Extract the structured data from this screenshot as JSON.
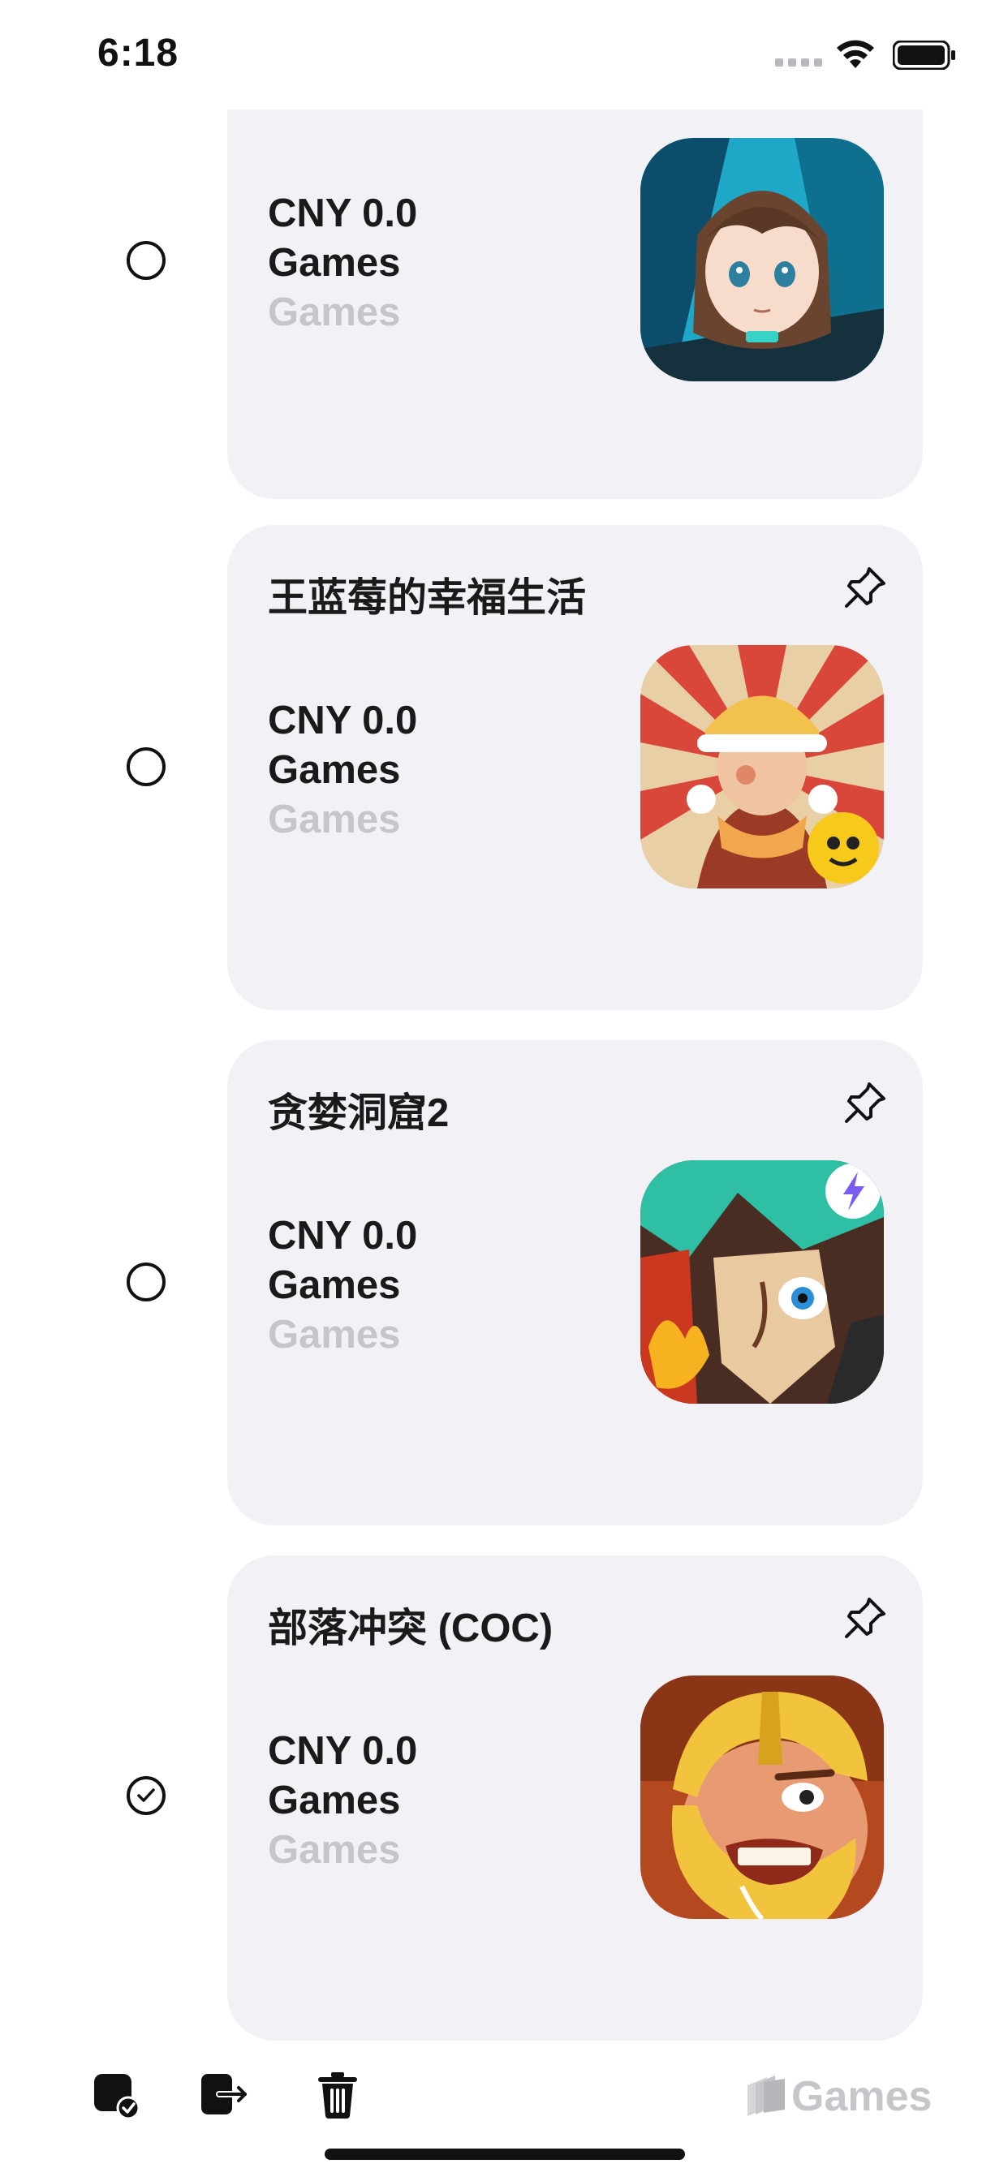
{
  "status_bar": {
    "time": "6:18"
  },
  "items": [
    {
      "title": "",
      "price": "CNY 0.0",
      "category": "Games",
      "genre": "Games",
      "selected": false,
      "icon": "anime-girl-game-icon"
    },
    {
      "title": "王蓝莓的幸福生活",
      "price": "CNY 0.0",
      "category": "Games",
      "genre": "Games",
      "selected": false,
      "icon": "boy-in-tiger-hat-game-icon"
    },
    {
      "title": "贪婪洞窟2",
      "price": "CNY 0.0",
      "category": "Games",
      "genre": "Games",
      "selected": false,
      "icon": "cave-hero-game-icon"
    },
    {
      "title": "部落冲突 (COC)",
      "price": "CNY 0.0",
      "category": "Games",
      "genre": "Games",
      "selected": true,
      "icon": "barbarian-game-icon"
    }
  ],
  "toolbar": {
    "filter_label": "Games",
    "icons": [
      "app-check-icon",
      "export-icon",
      "trash-icon",
      "stack-icon"
    ]
  },
  "colors": {
    "card_bg": "#f1f1f6",
    "muted_text": "#c6c6ca",
    "text": "#1a1a1a"
  }
}
